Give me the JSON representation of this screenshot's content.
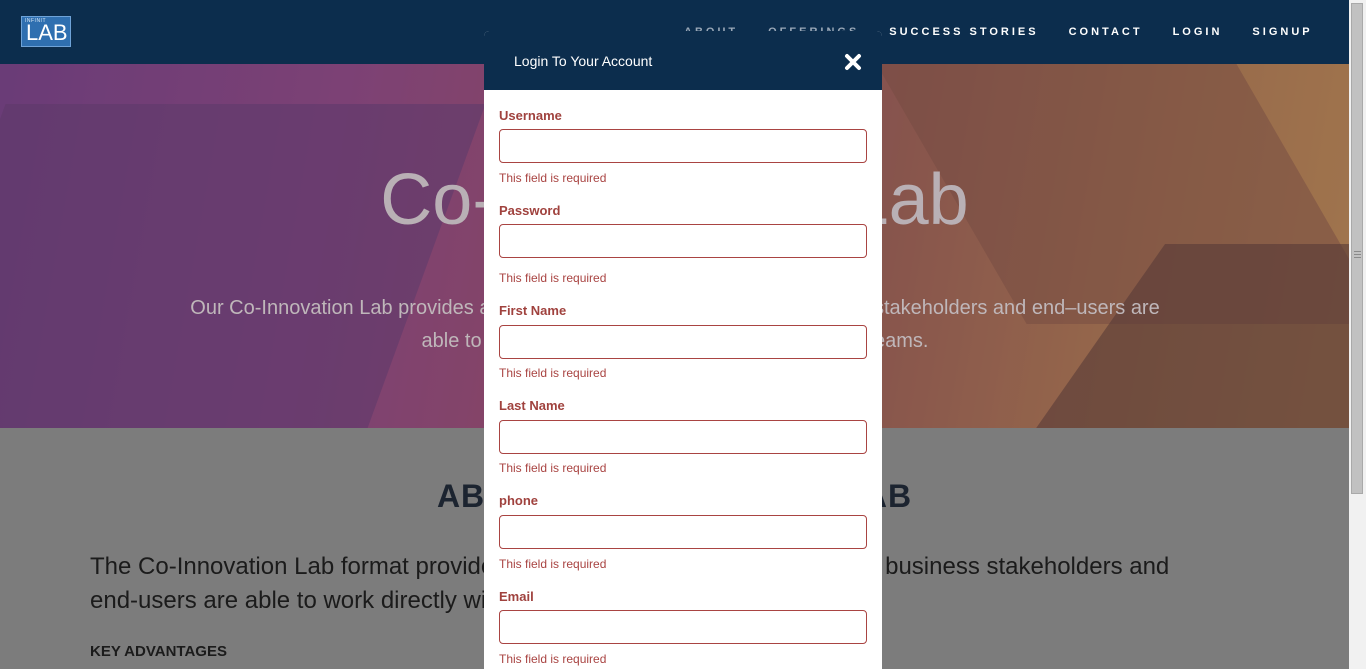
{
  "brand": {
    "logo_small": "INFINIT",
    "logo_text": "LAB"
  },
  "nav": {
    "items": [
      "ABOUT",
      "OFFERINGS",
      "SUCCESS STORIES",
      "CONTACT",
      "LOGIN",
      "SIGNUP"
    ]
  },
  "hero": {
    "title": "Co-Innovation Lab",
    "text": "Our Co-Innovation Lab provides a collaborative environment where business stakeholders and end–users are able to work directly with design and development teams."
  },
  "about": {
    "title": "ABOUT CO-INNOVATION LAB",
    "text": "The Co-Innovation Lab format provides a collaborative environment where business stakeholders and end-users are able to work directly with the design team",
    "key_advantages": "KEY ADVANTAGES"
  },
  "modal": {
    "title": "Login To Your Account",
    "fields": [
      {
        "label": "Username",
        "value": "",
        "error": "This field is required"
      },
      {
        "label": "Password",
        "value": "",
        "error": "This field is required"
      },
      {
        "label": "First Name",
        "value": "",
        "error": "This field is required"
      },
      {
        "label": "Last Name",
        "value": "",
        "error": "This field is required"
      },
      {
        "label": "phone",
        "value": "",
        "error": "This field is required"
      },
      {
        "label": "Email",
        "value": "",
        "error": "This field is required"
      }
    ]
  },
  "colors": {
    "header": "#0c2d4d",
    "error": "#a94442"
  }
}
